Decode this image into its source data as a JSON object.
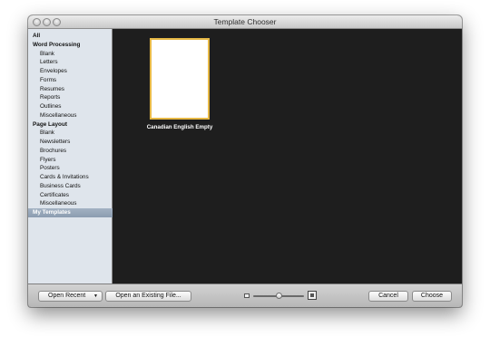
{
  "window": {
    "title": "Template Chooser"
  },
  "sidebar": {
    "items": [
      {
        "label": "All",
        "kind": "header"
      },
      {
        "label": "Word Processing",
        "kind": "header"
      },
      {
        "label": "Blank",
        "kind": "child"
      },
      {
        "label": "Letters",
        "kind": "child"
      },
      {
        "label": "Envelopes",
        "kind": "child"
      },
      {
        "label": "Forms",
        "kind": "child"
      },
      {
        "label": "Resumes",
        "kind": "child"
      },
      {
        "label": "Reports",
        "kind": "child"
      },
      {
        "label": "Outlines",
        "kind": "child"
      },
      {
        "label": "Miscellaneous",
        "kind": "child"
      },
      {
        "label": "Page Layout",
        "kind": "header"
      },
      {
        "label": "Blank",
        "kind": "child"
      },
      {
        "label": "Newsletters",
        "kind": "child"
      },
      {
        "label": "Brochures",
        "kind": "child"
      },
      {
        "label": "Flyers",
        "kind": "child"
      },
      {
        "label": "Posters",
        "kind": "child"
      },
      {
        "label": "Cards & Invitations",
        "kind": "child"
      },
      {
        "label": "Business Cards",
        "kind": "child"
      },
      {
        "label": "Certificates",
        "kind": "child"
      },
      {
        "label": "Miscellaneous",
        "kind": "child"
      },
      {
        "label": "My Templates",
        "kind": "header",
        "selected": true
      }
    ]
  },
  "templates": [
    {
      "label": "Canadian English Empty",
      "selected": true
    }
  ],
  "bottombar": {
    "open_recent": "Open Recent",
    "open_existing": "Open an Existing File...",
    "cancel": "Cancel",
    "choose": "Choose"
  },
  "icons": {
    "traffic_lights": [
      "close-icon",
      "minimize-icon",
      "zoom-icon"
    ],
    "caret": "chevron-down-icon",
    "zoom_small": "small-thumbnail-icon",
    "zoom_large": "large-thumbnail-icon"
  },
  "thumbnail_zoom_level": 0.45,
  "colors": {
    "selection_border": "#e6b845",
    "content_background": "#1e1e1e",
    "sidebar_background": "#dfe5ec"
  }
}
